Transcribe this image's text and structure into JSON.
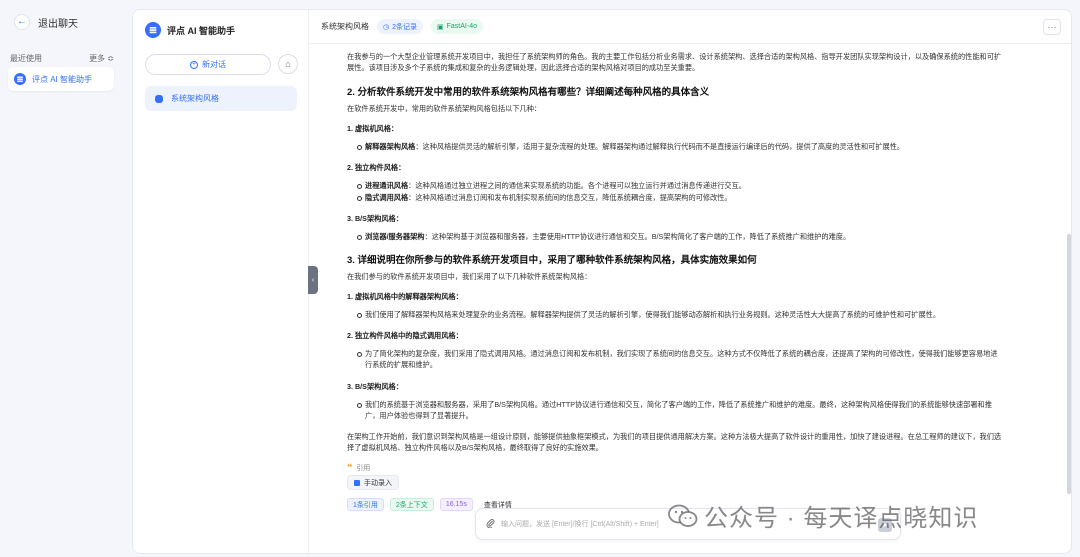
{
  "sidebar": {
    "back_label": "退出聊天",
    "recent_label": "最近使用",
    "more_label": "更多 ≎",
    "recent_item": "评点 AI 智能助手"
  },
  "chatlist": {
    "app_name": "评点 AI 智能助手",
    "new_chat_label": "新对话",
    "items": [
      "系统架构风格"
    ]
  },
  "topbar": {
    "title": "系统架构风格",
    "records": "2条记录",
    "model": "FastAI-4o"
  },
  "content": {
    "intro": "在我参与的一个大型企业管理系统开发项目中，我担任了系统架构师的角色。我的主要工作包括分析业务需求、设计系统架构、选择合适的架构风格、指导开发团队实现架构设计，以及确保系统的性能和可扩展性。该项目涉及多个子系统的集成和复杂的业务逻辑处理，因此选择合适的架构风格对项目的成功至关重要。",
    "h2": "2. 分析软件系统开发中常用的软件系统架构风格有哪些？详细阐述每种风格的具体含义",
    "p2": "在软件系统开发中，常用的软件系统架构风格包括以下几种：",
    "s1": "1. 虚拟机风格：",
    "s1b1_bold": "解释器架构风格",
    "s1b1": "：这种风格提供灵活的解析引擎，适用于复杂流程的处理。解释器架构通过解释执行代码而不是直接运行编译后的代码，提供了高度的灵活性和可扩展性。",
    "s2": "2. 独立构件风格：",
    "s2b1_bold": "进程通讯风格",
    "s2b1": "：这种风格通过独立进程之间的通信来实现系统的功能。各个进程可以独立运行并通过消息传递进行交互。",
    "s2b2_bold": "隐式调用风格",
    "s2b2": "：这种风格通过消息订阅和发布机制实现系统间的信息交互，降低系统耦合度，提高架构的可修改性。",
    "s3": "3. B/S架构风格：",
    "s3b1_bold": "浏览器/服务器架构",
    "s3b1": "：这种架构基于浏览器和服务器，主要使用HTTP协议进行通信和交互。B/S架构简化了客户端的工作，降低了系统推广和维护的难度。",
    "h3": "3. 详细说明在你所参与的软件系统开发项目中，采用了哪种软件系统架构风格，具体实施效果如何",
    "p3": "在我们参与的软件系统开发项目中，我们采用了以下几种软件系统架构风格：",
    "t1": "1. 虚拟机风格中的解释器架构风格：",
    "t1b1": "我们使用了解释器架构风格来处理复杂的业务流程。解释器架构提供了灵活的解析引擎，使得我们能够动态解析和执行业务规则。这种灵活性大大提高了系统的可维护性和可扩展性。",
    "t2": "2. 独立构件风格中的隐式调用风格：",
    "t2b1": "为了简化架构的复杂度，我们采用了隐式调用风格。通过消息订阅和发布机制，我们实现了系统间的信息交互。这种方式不仅降低了系统的耦合度，还提高了架构的可修改性，使得我们能够更容易地进行系统的扩展和维护。",
    "t3": "3. B/S架构风格：",
    "t3b1": "我们的系统基于浏览器和服务器，采用了B/S架构风格。通过HTTP协议进行通信和交互，简化了客户端的工作，降低了系统推广和维护的难度。最终，这种架构风格使得我们的系统能够快速部署和推广，用户体验也得到了显著提升。",
    "conclusion": "在架构工作开始前，我们意识到架构风格是一组设计原则，能够提供抽象框架模式，为我们的项目提供通用解决方案。这种方法极大提高了软件设计的重用性，加快了建设进程。在总工程师的建议下，我们选择了虚拟机风格、独立构件风格以及B/S架构风格，最终取得了良好的实施效果。"
  },
  "footer_meta": {
    "cite_label": "引用",
    "manual_label": "手动录入",
    "stat_quote": "1条引用",
    "stat_context": "2条上下文",
    "stat_time": "16.15s",
    "stat_detail": "查看详情"
  },
  "input": {
    "placeholder": "输入问题，发送 [Enter]/换行 [Ctrl(Alt/Shift) + Enter]"
  },
  "watermark": {
    "text": "公众号 · 每天译点晓知识"
  },
  "colors": {
    "accent": "#3370ff",
    "green": "#13a56d",
    "purple": "#8b5cf6"
  }
}
